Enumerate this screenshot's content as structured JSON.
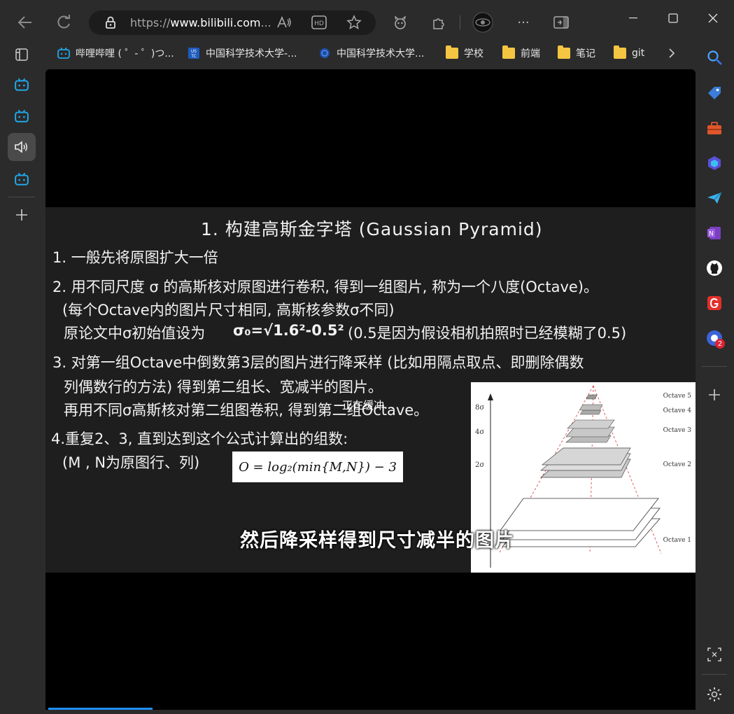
{
  "browser": {
    "url_prefix": "https://",
    "url_host": "www.bilibili.com",
    "url_suffix": "...",
    "read_aloud_label": "A)",
    "hd_label": "HD"
  },
  "bookmarks": [
    {
      "label": "哔哩哔哩 ( ゜- ゜)つ..."
    },
    {
      "label": "中国科学技术大学-..."
    },
    {
      "label": "中国科学技术大学..."
    },
    {
      "label": "学校"
    },
    {
      "label": "前端"
    },
    {
      "label": "笔记"
    },
    {
      "label": "git"
    }
  ],
  "right_sidebar": {
    "badge_count": "2"
  },
  "slide": {
    "title": "1. 构建高斯金字塔 (Gaussian Pyramid)",
    "lines": [
      "1. 一般先将原图扩大一倍",
      "2. 用不同尺度 σ 的高斯核对原图进行卷积, 得到一组图片, 称为一个八度(Octave)。",
      "(每个Octave内的图片尺寸相同, 高斯核参数σ不同)",
      "原论文中σ初始值设为",
      "σ₀=√1.6²-0.5²",
      "(0.5是因为假设相机拍照时已经模糊了0.5)",
      "3.  对第一组Octave中倒数第3层的图片进行降采样 (比如用隔点取点、即删除偶数",
      "列偶数行的方法) 得到第二组长、宽减半的图片。",
      "再用不同σ高斯核对第二组图卷积, 得到第二组Octave。",
      "4.重复2、3, 直到达到这个公式计算出的组数:",
      "(M , N为原图行、列)"
    ],
    "formula": "O = log₂(min{M,N}) − 3",
    "pyramid_labels": {
      "octaves": [
        "Octave 5",
        "Octave 4",
        "Octave 3",
        "Octave 2",
        "Octave 1"
      ],
      "sigmas": [
        "8σ",
        "4σ",
        "2σ"
      ]
    }
  },
  "player": {
    "buffering_text": "正在缓冲...",
    "subtitle": "然后降采样得到尺寸减半的图片"
  }
}
